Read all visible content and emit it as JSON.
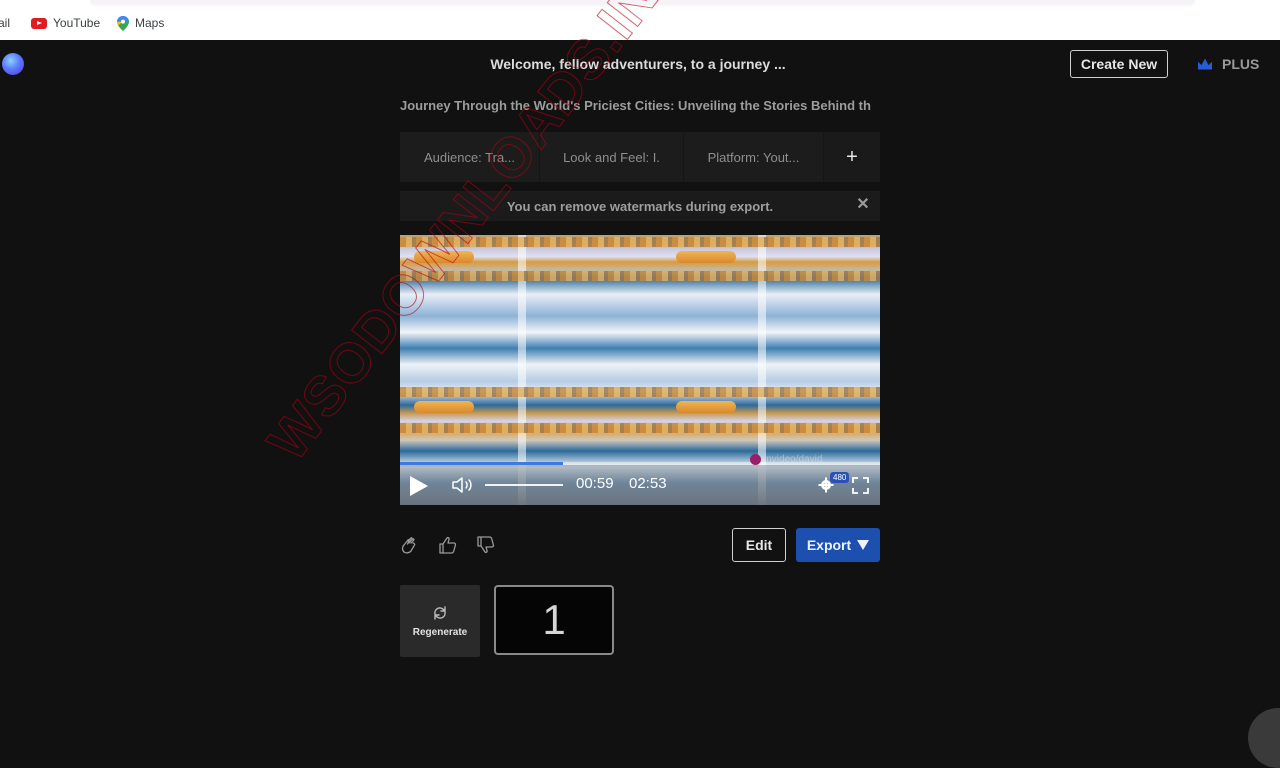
{
  "browser": {
    "bookmarks": [
      {
        "label": "ail",
        "icon": "gmail-icon"
      },
      {
        "label": "YouTube",
        "icon": "youtube-icon"
      },
      {
        "label": "Maps",
        "icon": "maps-icon"
      }
    ]
  },
  "header": {
    "title": "Welcome, fellow adventurers, to a journey ...",
    "create_new_label": "Create New",
    "plan_label": "PLUS",
    "plan_icon": "crown-icon"
  },
  "video_subtitle": "Journey Through the World's Priciest Cities: Unveiling the Stories Behind th",
  "tags": [
    {
      "label": "Audience: Tra..."
    },
    {
      "label": "Look and Feel: I."
    },
    {
      "label": "Platform: Yout..."
    }
  ],
  "tags_add_label": "+",
  "notice": {
    "text": "You can remove watermarks during export.",
    "close_label": "✕"
  },
  "player": {
    "current_time": "00:59",
    "duration": "02:53",
    "progress_fraction": 0.34,
    "quality_badge": "480",
    "brand_watermark": "invideo/david"
  },
  "actions": {
    "edit_label": "Edit",
    "export_label": "Export",
    "regenerate_label": "Regenerate",
    "version_number": "1"
  },
  "colors": {
    "accent": "#1d4fae",
    "background": "#111111",
    "progress": "#3d7be0"
  },
  "overlay_watermark": "WSODOWNLOADS.IN"
}
